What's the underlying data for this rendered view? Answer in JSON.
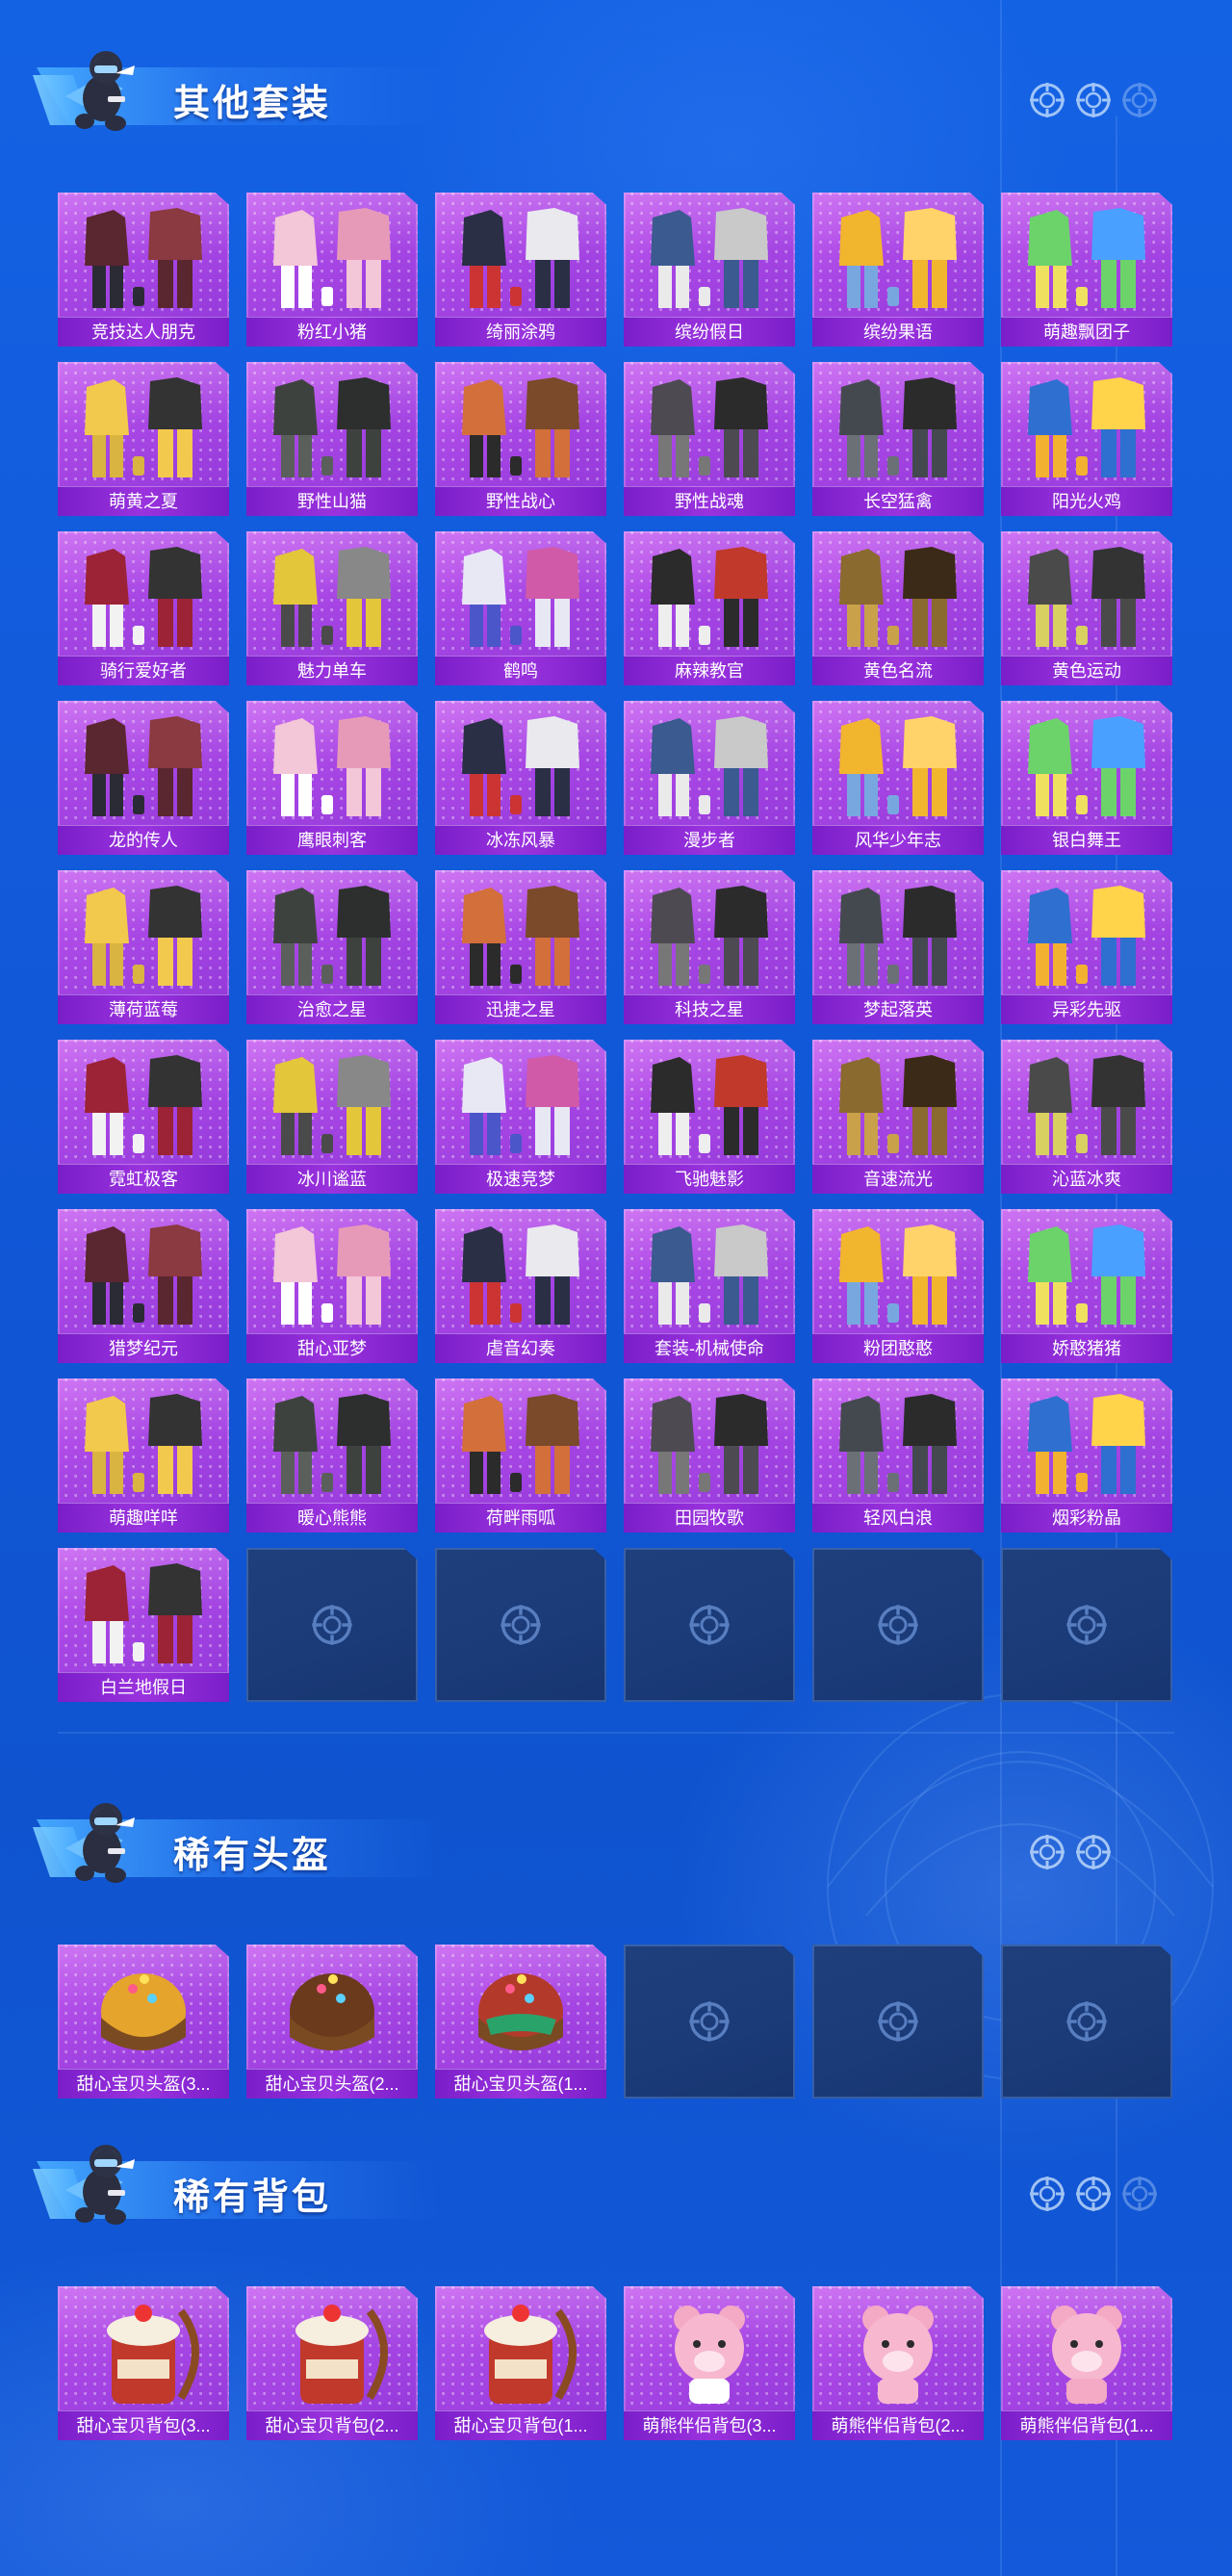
{
  "colors": {
    "background": "#1255d6",
    "card_purple": "#a746e4",
    "label_purple": "#8a2bd6",
    "empty_slot": "#1e3f7c"
  },
  "sections": [
    {
      "title": "其他套装",
      "icons": [
        "crosshair-icon",
        "crosshair-icon",
        "crosshair-icon"
      ],
      "items": [
        {
          "label": "竞技达人朋克"
        },
        {
          "label": "粉红小猪"
        },
        {
          "label": "绮丽涂鸦"
        },
        {
          "label": "缤纷假日"
        },
        {
          "label": "缤纷果语"
        },
        {
          "label": "萌趣飘团子"
        },
        {
          "label": "萌黄之夏"
        },
        {
          "label": "野性山猫"
        },
        {
          "label": "野性战心"
        },
        {
          "label": "野性战魂"
        },
        {
          "label": "长空猛禽"
        },
        {
          "label": "阳光火鸡"
        },
        {
          "label": "骑行爱好者"
        },
        {
          "label": "魅力单车"
        },
        {
          "label": "鹤鸣"
        },
        {
          "label": "麻辣教官"
        },
        {
          "label": "黄色名流"
        },
        {
          "label": "黄色运动"
        },
        {
          "label": "龙的传人"
        },
        {
          "label": "鹰眼刺客"
        },
        {
          "label": "冰冻风暴"
        },
        {
          "label": "漫步者"
        },
        {
          "label": "风华少年志"
        },
        {
          "label": "银白舞王"
        },
        {
          "label": "薄荷蓝莓"
        },
        {
          "label": "治愈之星"
        },
        {
          "label": "迅捷之星"
        },
        {
          "label": "科技之星"
        },
        {
          "label": "梦起落英"
        },
        {
          "label": "异彩先驱"
        },
        {
          "label": "霓虹极客"
        },
        {
          "label": "冰川谧蓝"
        },
        {
          "label": "极速竞梦"
        },
        {
          "label": "飞驰魅影"
        },
        {
          "label": "音速流光"
        },
        {
          "label": "沁蓝冰爽"
        },
        {
          "label": "猎梦纪元"
        },
        {
          "label": "甜心亚梦"
        },
        {
          "label": "虐音幻奏"
        },
        {
          "label": "套装-机械使命"
        },
        {
          "label": "粉团憨憨"
        },
        {
          "label": "娇憨猪猪"
        },
        {
          "label": "萌趣咩咩"
        },
        {
          "label": "暖心熊熊"
        },
        {
          "label": "荷畔雨呱"
        },
        {
          "label": "田园牧歌"
        },
        {
          "label": "轻风白浪"
        },
        {
          "label": "烟彩粉晶"
        },
        {
          "label": "白兰地假日"
        }
      ],
      "empty_slots": 5
    },
    {
      "title": "稀有头盔",
      "icons": [
        "crosshair-icon",
        "crosshair-icon"
      ],
      "items": [
        {
          "label": "甜心宝贝头盔(3..."
        },
        {
          "label": "甜心宝贝头盔(2..."
        },
        {
          "label": "甜心宝贝头盔(1..."
        }
      ],
      "empty_slots": 3
    },
    {
      "title": "稀有背包",
      "icons": [
        "crosshair-icon",
        "crosshair-icon",
        "crosshair-icon"
      ],
      "items": [
        {
          "label": "甜心宝贝背包(3..."
        },
        {
          "label": "甜心宝贝背包(2..."
        },
        {
          "label": "甜心宝贝背包(1..."
        },
        {
          "label": "萌熊伴侣背包(3..."
        },
        {
          "label": "萌熊伴侣背包(2..."
        },
        {
          "label": "萌熊伴侣背包(1..."
        }
      ],
      "empty_slots": 0
    }
  ]
}
